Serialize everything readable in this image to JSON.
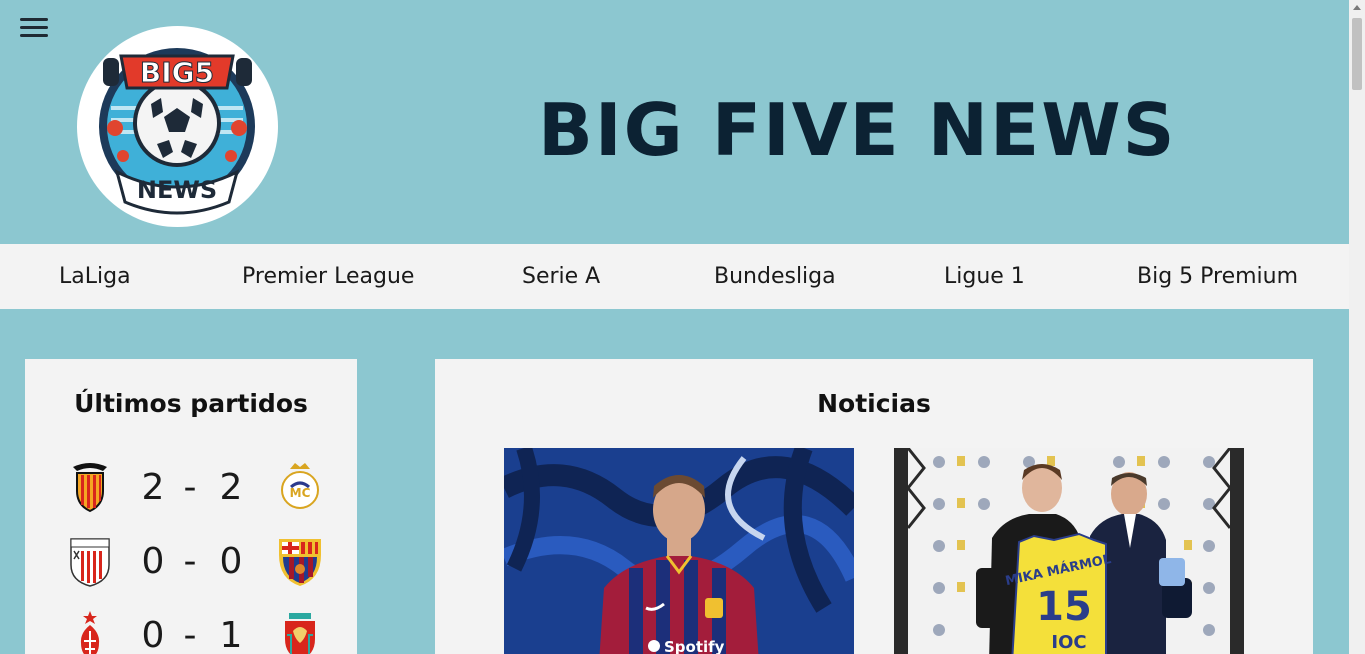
{
  "header": {
    "title": "BIG FIVE NEWS",
    "logo": {
      "top_text": "BIG5",
      "bottom_text": "NEWS"
    }
  },
  "nav": {
    "items": [
      "LaLiga",
      "Premier League",
      "Serie A",
      "Bundesliga",
      "Ligue 1",
      "Big 5 Premium"
    ]
  },
  "matches": {
    "title": "Últimos partidos",
    "dash": "-",
    "rows": [
      {
        "home": "Valencia",
        "home_score": "2",
        "away_score": "2",
        "away": "Real Madrid"
      },
      {
        "home": "Athletic Club",
        "home_score": "0",
        "away_score": "0",
        "away": "FC Barcelona"
      },
      {
        "home": "Nottingham Forest",
        "home_score": "0",
        "away_score": "1",
        "away": "Liverpool"
      }
    ]
  },
  "news": {
    "title": "Noticias",
    "articles": [
      {
        "image_text": "Spotify"
      },
      {
        "image_text": "MIKA MÁRMOL",
        "number": "15",
        "sponsor": "IOC"
      }
    ]
  },
  "colors": {
    "background": "#8cc7d0",
    "panel": "#f3f3f3",
    "title": "#0c2233"
  }
}
